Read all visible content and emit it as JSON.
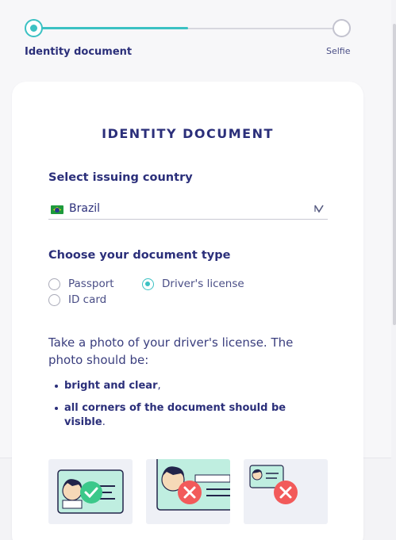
{
  "stepper": {
    "steps": [
      {
        "label": "Identity document",
        "state": "active"
      },
      {
        "label": "Selfie",
        "state": "upcoming"
      }
    ],
    "progress": 0.5
  },
  "card": {
    "title": "IDENTITY DOCUMENT",
    "country_section_label": "Select issuing country",
    "country_value": "Brazil",
    "doc_type_section_label": "Choose your document type",
    "doc_types": [
      {
        "label": "Passport",
        "checked": false
      },
      {
        "label": "Driver's license",
        "checked": true
      },
      {
        "label": "ID card",
        "checked": false
      }
    ],
    "instructions": "Take a photo of your driver's license. The photo should be:",
    "bullets": [
      {
        "bold": "bright and clear",
        "rest": ","
      },
      {
        "bold": "all corners of the document should be visible",
        "rest": "."
      }
    ]
  },
  "colors": {
    "accent": "#3bc1c3",
    "primary_text": "#2b2f7a",
    "error": "#f25a5a",
    "success": "#3bc88a"
  },
  "icons": [
    "flag-brazil-icon",
    "chevron-down-icon",
    "check-icon",
    "cross-icon"
  ]
}
